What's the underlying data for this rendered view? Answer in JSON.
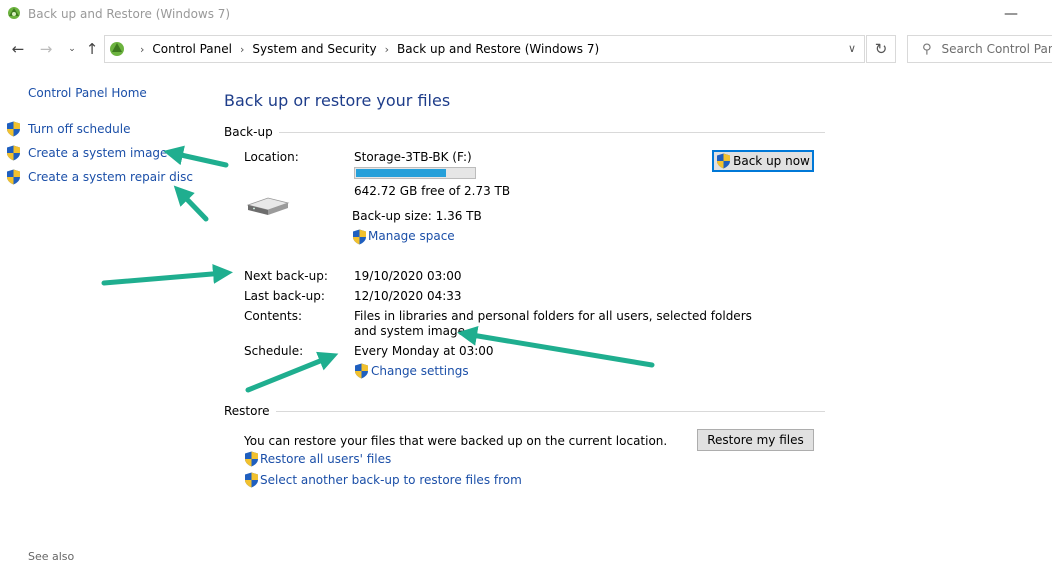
{
  "window": {
    "title": "Back up and Restore (Windows 7)"
  },
  "address_bar": {
    "breadcrumbs": [
      "Control Panel",
      "System and Security",
      "Back up and Restore (Windows 7)"
    ],
    "search_placeholder": "Search Control Panel"
  },
  "sidebar": {
    "home": "Control Panel Home",
    "items": [
      {
        "label": "Turn off schedule",
        "icon": "shield-icon"
      },
      {
        "label": "Create a system image",
        "icon": "shield-icon"
      },
      {
        "label": "Create a system repair disc",
        "icon": "shield-icon"
      }
    ],
    "see_also": "See also"
  },
  "main": {
    "heading": "Back up or restore your files",
    "backup": {
      "section_label": "Back-up",
      "location_label": "Location:",
      "location_value": "Storage-3TB-BK (F:)",
      "progress_fraction": 0.77,
      "free_space": "642.72 GB free of 2.73 TB",
      "backup_size": "Back-up size: 1.36 TB",
      "manage_space": "Manage space",
      "backup_now": "Back up now",
      "next_label": "Next back-up:",
      "next_value": "19/10/2020 03:00",
      "last_label": "Last back-up:",
      "last_value": "12/10/2020 04:33",
      "contents_label": "Contents:",
      "contents_line1": "Files in libraries and personal folders for all users, selected folders",
      "contents_line2": "and system image",
      "schedule_label": "Schedule:",
      "schedule_value": "Every Monday at 03:00",
      "change_settings": "Change settings"
    },
    "restore": {
      "section_label": "Restore",
      "description": "You can restore your files that were backed up on the current location.",
      "restore_my_files": "Restore my files",
      "restore_all_users": "Restore all users' files",
      "select_another": "Select another back-up to restore files from"
    }
  },
  "colors": {
    "link": "#1b4fa8",
    "heading": "#1e3d8a",
    "annotation_arrow": "#1fae8f",
    "progress_fill": "#26a0da"
  }
}
